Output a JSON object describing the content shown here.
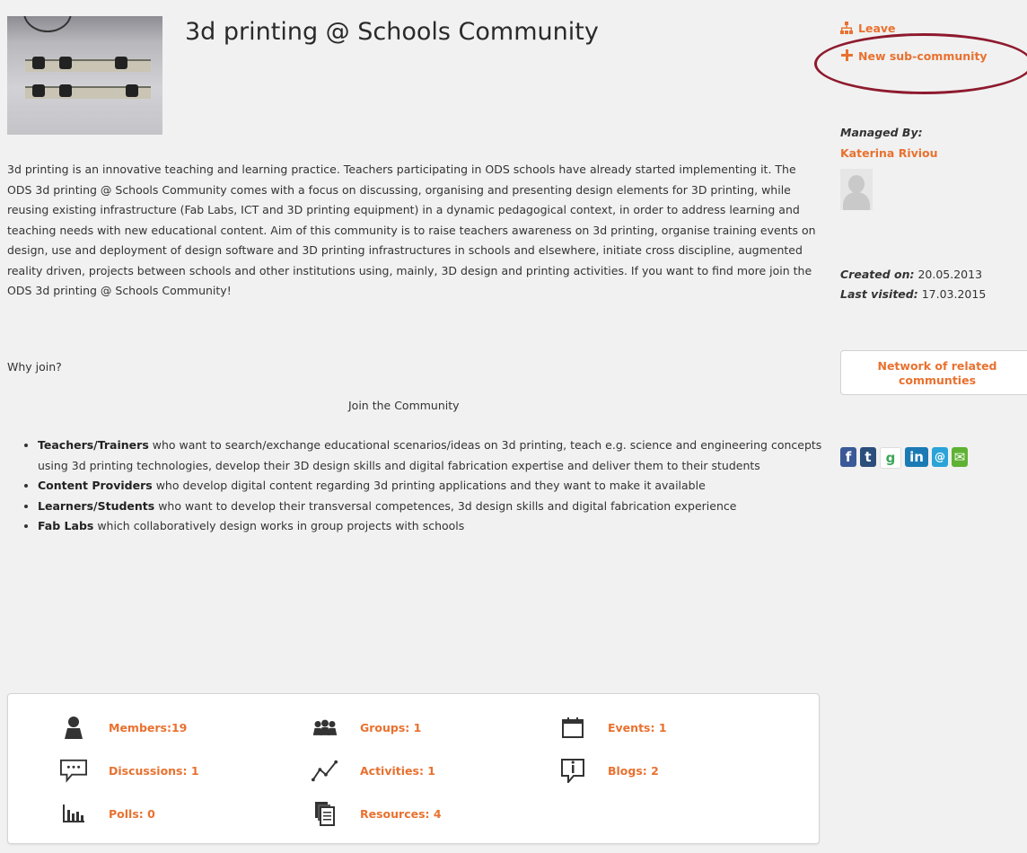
{
  "community": {
    "title": "3d printing @ Schools Community",
    "description": "3d printing is an innovative teaching and learning practice. Teachers participating in ODS schools have already started implementing it.  The ODS 3d printing @ Schools Community comes with a focus on discussing, organising and presenting design elements for 3D printing, while reusing existing infrastructure (Fab Labs, ICT and 3D printing equipment) in a dynamic pedagogical context, in order to address learning and teaching needs with new educational content.  Aim of this community is to raise teachers awareness on 3d printing, organise training events on design, use and deployment of design software and 3D printing infrastructures in schools and elsewhere, initiate cross discipline, augmented reality driven, projects between schools and other institutions using, mainly, 3D design and printing activities. If you want to find more join the ODS 3d printing @ Schools Community!",
    "why_join": "Why join?",
    "join_link": "Join the Community",
    "bullets": [
      {
        "bold": "Teachers/Trainers",
        "text": " who want to search/exchange educational scenarios/ideas on 3d printing, teach e.g. science and engineering concepts using 3d printing technologies, develop their 3D design skills and digital fabrication expertise and deliver them to their students"
      },
      {
        "bold": "Content Providers",
        "text": " who develop digital content regarding  3d printing applications and they want to make it available"
      },
      {
        "bold": "Learners/Students",
        "text": " who want to develop their transversal competences, 3d design skills and digital fabrication experience"
      },
      {
        "bold": "Fab Labs",
        "text": " which collaboratively design works in group projects with schools"
      }
    ]
  },
  "sidebar": {
    "leave_label": "Leave",
    "new_sub_label": "New sub-community",
    "managed_by_label": "Managed By:",
    "manager_name": "Katerina Riviou",
    "created_label": "Created on:",
    "created_value": " 20.05.2013",
    "visited_label": "Last visited:",
    "visited_value": " 17.03.2015",
    "network_button": "Network of related communties",
    "social": [
      {
        "icon": "facebook-icon",
        "glyph": "f"
      },
      {
        "icon": "tumblr-icon",
        "glyph": "t"
      },
      {
        "icon": "google-plus-icon",
        "glyph": "g"
      },
      {
        "icon": "linkedin-icon",
        "glyph": "in"
      },
      {
        "icon": "at-mention-icon",
        "glyph": "@"
      },
      {
        "icon": "email-icon",
        "glyph": "✉"
      }
    ]
  },
  "stats": {
    "members": "Members:19",
    "groups": "Groups: 1",
    "events": "Events: 1",
    "discussions": "Discussions: 1",
    "activities": "Activities: 1",
    "blogs": "Blogs: 2",
    "polls": "Polls: 0",
    "resources": "Resources: 4"
  },
  "colors": {
    "accent": "#e9712f",
    "highlight_ellipse": "#8e1a2e",
    "background": "#f1f1f1"
  }
}
